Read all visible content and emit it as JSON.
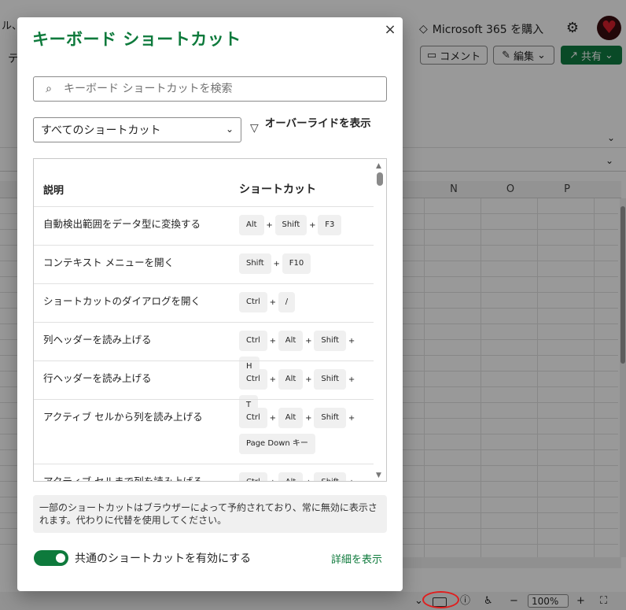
{
  "background": {
    "top_left_fragment": "ル、",
    "ms365_label": "Microsoft 365 を購入",
    "ms365_icon": "diamond-icon",
    "settings_icon": "gear-icon",
    "tab_fragment": "テ",
    "comment_label": "コメント",
    "edit_label": "編集",
    "share_label": "共有",
    "share_color": "#107c41",
    "column_headers": [
      "N",
      "O",
      "P"
    ],
    "zoom_value": "100%"
  },
  "dialog": {
    "title": "キーボード ショートカット",
    "title_color": "#0e7a3c",
    "close_label": "×",
    "search_placeholder": "キーボード ショートカットを検索",
    "filter_selected": "すべてのショートカット",
    "override_label": "オーバーライドを表示",
    "table": {
      "headers": [
        "説明",
        "ショートカット"
      ],
      "rows": [
        {
          "description": "自動検出範囲をデータ型に変換する",
          "keys": [
            "Alt",
            "Shift",
            "F3"
          ]
        },
        {
          "description": "コンテキスト メニューを開く",
          "keys": [
            "Shift",
            "F10"
          ]
        },
        {
          "description": "ショートカットのダイアログを開く",
          "keys": [
            "Ctrl",
            "/"
          ]
        },
        {
          "description": "列ヘッダーを読み上げる",
          "keys": [
            "Ctrl",
            "Alt",
            "Shift",
            "H"
          ]
        },
        {
          "description": "行ヘッダーを読み上げる",
          "keys": [
            "Ctrl",
            "Alt",
            "Shift",
            "T"
          ]
        },
        {
          "description": "アクティブ セルから列を読み上げる",
          "keys": [
            "Ctrl",
            "Alt",
            "Shift",
            "Page Down キー"
          ]
        },
        {
          "description": "アクティブ セルまで列を読み上げる",
          "keys": [
            "Ctrl",
            "Alt",
            "Shift"
          ]
        }
      ]
    },
    "notice": "一部のショートカットはブラウザーによって予約されており、常に無効に表示されます。代わりに代替を使用してください。",
    "toggle_label": "共通のショートカットを有効にする",
    "toggle_on": true,
    "details_link": "詳細を表示"
  }
}
